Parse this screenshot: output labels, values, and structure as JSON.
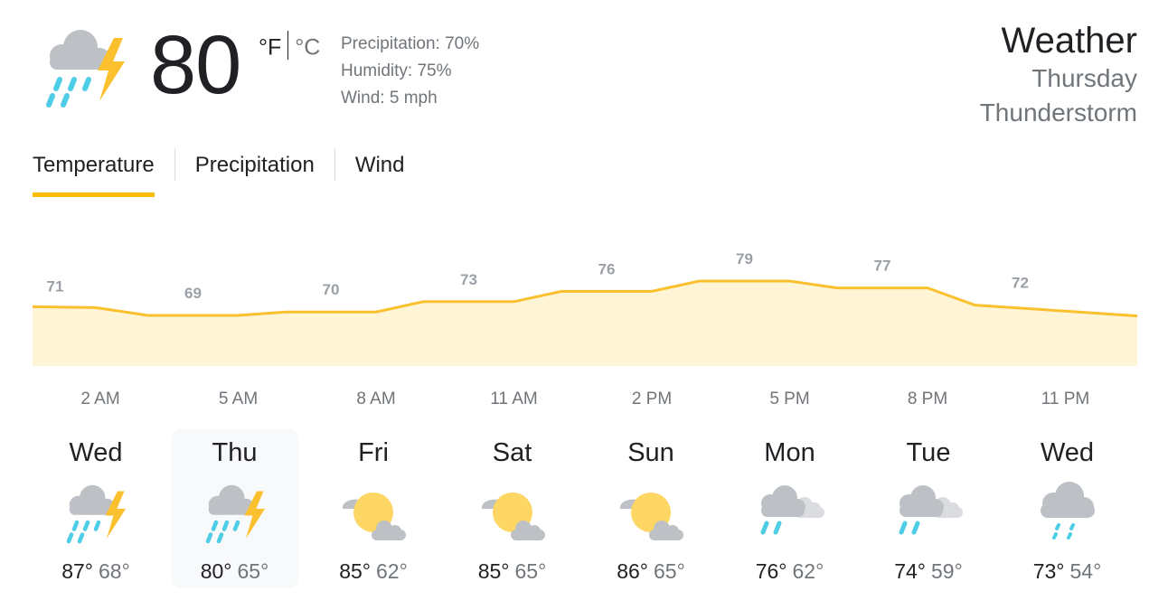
{
  "current": {
    "icon": "thunderstorm-icon",
    "temperature": "80",
    "unit_f": "°F",
    "unit_c": "°C",
    "precipitation": "Precipitation: 70%",
    "humidity": "Humidity: 75%",
    "wind": "Wind: 5 mph"
  },
  "header": {
    "title": "Weather",
    "day": "Thursday",
    "condition": "Thunderstorm"
  },
  "tabs": [
    {
      "label": "Temperature",
      "active": true
    },
    {
      "label": "Precipitation",
      "active": false
    },
    {
      "label": "Wind",
      "active": false
    }
  ],
  "colors": {
    "accent": "#fbbc04",
    "line": "#fbc02d",
    "fill": "#fef5d7",
    "label": "#9aa0a6"
  },
  "chart_data": {
    "type": "area",
    "series": [
      {
        "values": [
          71,
          69,
          70,
          73,
          76,
          79,
          77,
          72
        ]
      }
    ],
    "categories": [
      "2 AM",
      "5 AM",
      "8 AM",
      "11 AM",
      "2 PM",
      "5 PM",
      "8 PM",
      "11 PM"
    ],
    "ylim": [
      55,
      90
    ],
    "grid": false
  },
  "days": [
    {
      "name": "Wed",
      "icon": "thunderstorm-icon",
      "high": "87°",
      "low": "68°",
      "selected": false
    },
    {
      "name": "Thu",
      "icon": "thunderstorm-icon",
      "high": "80°",
      "low": "65°",
      "selected": true
    },
    {
      "name": "Fri",
      "icon": "partly-cloudy-icon",
      "high": "85°",
      "low": "62°",
      "selected": false
    },
    {
      "name": "Sat",
      "icon": "partly-cloudy-icon",
      "high": "85°",
      "low": "65°",
      "selected": false
    },
    {
      "name": "Sun",
      "icon": "partly-cloudy-icon",
      "high": "86°",
      "low": "65°",
      "selected": false
    },
    {
      "name": "Mon",
      "icon": "cloudy-rain-icon",
      "high": "76°",
      "low": "62°",
      "selected": false
    },
    {
      "name": "Tue",
      "icon": "cloudy-rain-icon",
      "high": "74°",
      "low": "59°",
      "selected": false
    },
    {
      "name": "Wed",
      "icon": "light-rain-icon",
      "high": "73°",
      "low": "54°",
      "selected": false
    }
  ]
}
